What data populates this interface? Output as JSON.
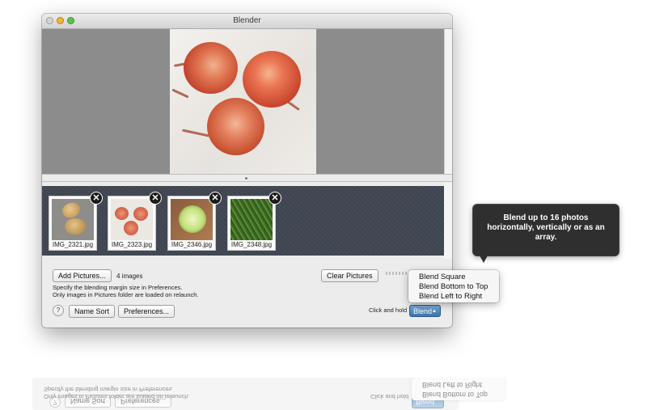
{
  "window": {
    "title": "Blender"
  },
  "thumbnails": [
    {
      "name": "IMG_2321.jpg",
      "remove_label": "✕"
    },
    {
      "name": "IMG_2323.jpg",
      "remove_label": "✕"
    },
    {
      "name": "IMG_2346.jpg",
      "remove_label": "✕"
    },
    {
      "name": "IMG_2348.jpg",
      "remove_label": "✕"
    }
  ],
  "controls": {
    "add_pictures": "Add Pictures...",
    "image_count": "4 images",
    "hint_line1": "Specify the blending margin size in Preferences.",
    "hint_line2": "Only images in Pictures folder are loaded on relaunch.",
    "clear_pictures": "Clear Pictures",
    "click_hint": "Click and hold",
    "help_label": "?",
    "name_sort": "Name Sort",
    "preferences": "Preferences...",
    "blend": "Blend",
    "blend_arrow": "▲"
  },
  "blend_menu": {
    "items": [
      "Blend Square",
      "Blend Bottom to Top",
      "Blend Left to Right"
    ]
  },
  "tooltip": {
    "text": "Blend up to 16 photos horizontally, vertically or as an array."
  },
  "reflection": {
    "help_label": "?",
    "name_sort": "Name Sort",
    "preferences": "Preferences...",
    "blend": "Blend",
    "hint_line1": "Specify the blending margin size in Preferences.",
    "hint_line2": "Only images in Pictures folder are loaded on relaunch.",
    "click_hint": "Click and hold",
    "menu_item_1": "Blend Bottom to Top",
    "menu_item_2": "Blend Left to Right"
  },
  "colors": {
    "accent": "#3a73ad",
    "strip_bg": "#3f4550",
    "preview_bg": "#8c8c8c",
    "tooltip_bg": "#2f2f2f"
  }
}
